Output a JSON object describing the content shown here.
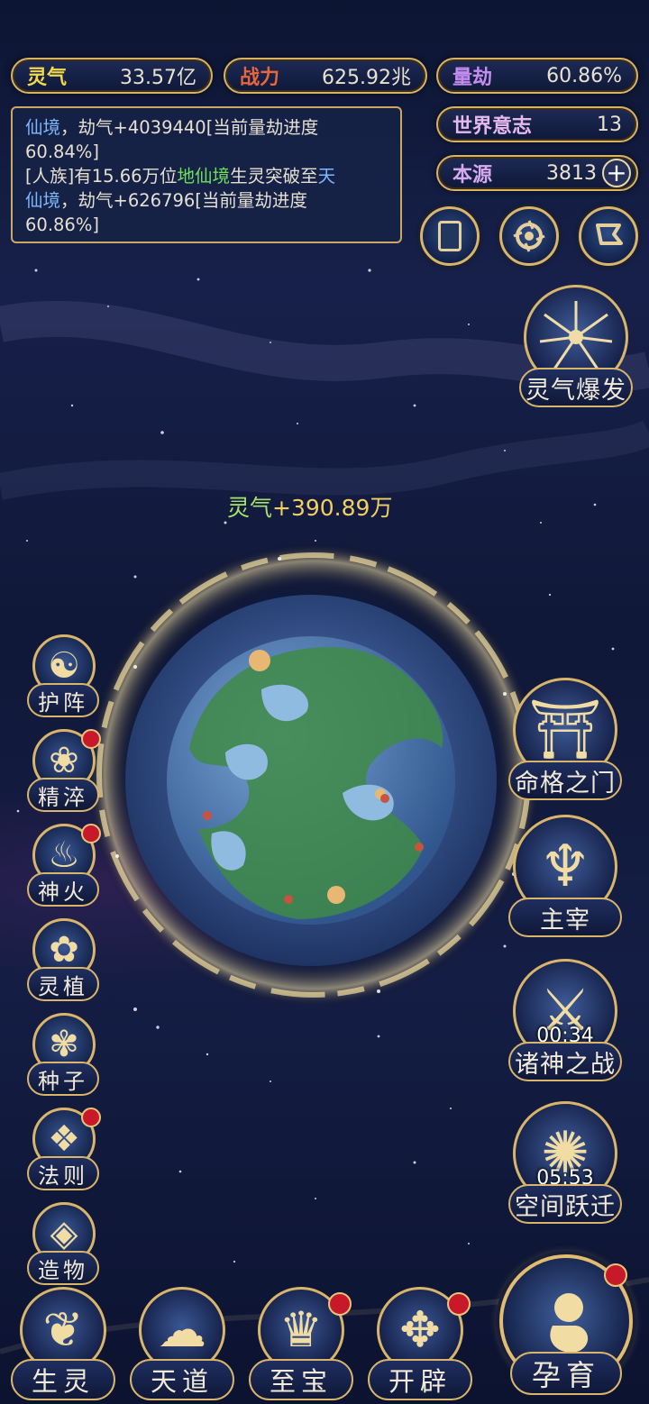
{
  "colors": {
    "accent_gold": "#d9b56a",
    "lingqi_label": "#f2d94a",
    "zhanli_label": "#e8663c",
    "liangjie_label": "#c58cf0",
    "shijie_label": "#e5b8f0",
    "benyuan_label": "#d7a9ef",
    "link_blue": "#7fb7ff",
    "green_hl": "#6fe05a",
    "gain_value": "#f2cf62"
  },
  "stats": {
    "lingqi": {
      "label": "灵气",
      "value": "33.57亿"
    },
    "zhanli": {
      "label": "战力",
      "value": "625.92兆"
    },
    "liangjie": {
      "label": "量劫",
      "value": "60.86%"
    },
    "shijie": {
      "label": "世界意志",
      "value": "13"
    },
    "benyuan": {
      "label": "本源",
      "value": "3813",
      "add_icon": "plus-icon"
    }
  },
  "log": {
    "line1_hl": "仙境",
    "line1": "，劫气+4039440[当前量劫进度",
    "line2": "60.84%]",
    "line3_a": "[人族]有15.66万位",
    "line3_hl": "地仙境",
    "line3_b": "生灵突破至",
    "line3_hl2": "天",
    "line4_hl": "仙境",
    "line4": "，劫气+626796[当前量劫进度",
    "line5": "60.86%]"
  },
  "top_icons": [
    "cards-icon",
    "swirl-icon",
    "flag-icon"
  ],
  "burst": {
    "label": "灵气爆发",
    "icon": "burst-icon"
  },
  "gain": {
    "prefix": "灵气",
    "value": "+390.89万"
  },
  "left_menu": [
    {
      "label": "护阵",
      "icon": "yinyang-icon",
      "badge": false
    },
    {
      "label": "精淬",
      "icon": "flame-lotus-icon",
      "badge": true
    },
    {
      "label": "神火",
      "icon": "fire-icon",
      "badge": true
    },
    {
      "label": "灵植",
      "icon": "plant-icon",
      "badge": false
    },
    {
      "label": "种子",
      "icon": "flower-icon",
      "badge": false
    },
    {
      "label": "法则",
      "icon": "rune-icon",
      "badge": true
    },
    {
      "label": "造物",
      "icon": "diamond-icon",
      "badge": false
    }
  ],
  "right_menu": [
    {
      "label": "命格之门",
      "icon": "gate-icon",
      "timer": ""
    },
    {
      "label": "主宰",
      "icon": "dragon-icon",
      "timer": ""
    },
    {
      "label": "诸神之战",
      "icon": "sword-icon",
      "timer": "00:34"
    },
    {
      "label": "空间跃迁",
      "icon": "vortex-icon",
      "timer": "05:53"
    }
  ],
  "bottom_menu": [
    {
      "label": "生灵",
      "icon": "life-icon",
      "badge": false
    },
    {
      "label": "天道",
      "icon": "cloud-icon",
      "badge": false
    },
    {
      "label": "至宝",
      "icon": "treasure-icon",
      "badge": true
    },
    {
      "label": "开辟",
      "icon": "axe-icon",
      "badge": true
    }
  ],
  "yuyu": {
    "label": "孕育",
    "icon": "embryo-icon",
    "badge": true
  }
}
